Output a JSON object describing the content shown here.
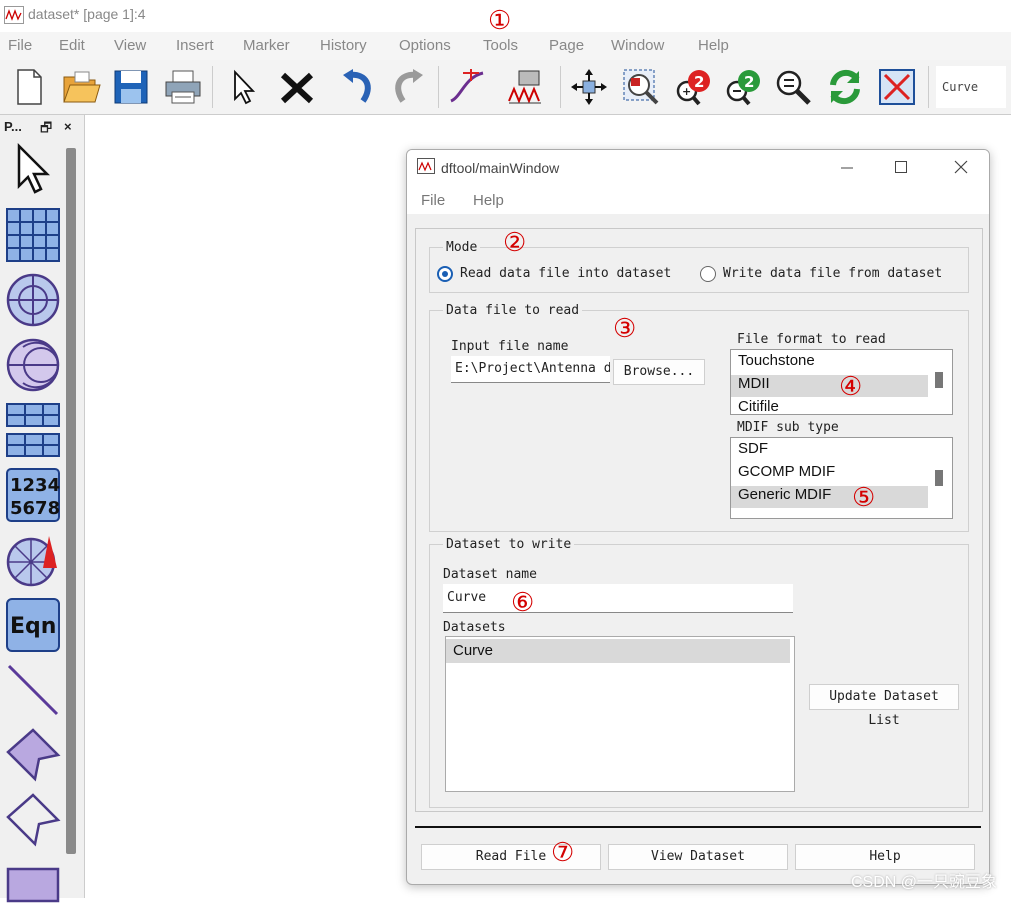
{
  "window": {
    "title": "dataset* [page 1]:4"
  },
  "menu": [
    "File",
    "Edit",
    "View",
    "Insert",
    "Marker",
    "History",
    "Options",
    "Tools",
    "Page",
    "Window",
    "Help"
  ],
  "toolbar": {
    "icons": [
      "new-file-icon",
      "open-folder-icon",
      "save-icon",
      "print-icon",
      "pointer-icon",
      "delete-icon",
      "undo-icon",
      "redo-icon",
      "trace-icon",
      "plot-settings-icon",
      "pan-icon",
      "zoom-box-icon",
      "zoom-in-icon",
      "zoom-out-icon",
      "zoom-fit-icon",
      "refresh-icon",
      "clear-icon"
    ],
    "curve_field": "Curve"
  },
  "palette": {
    "title": "P...",
    "float_glyph": "🗗",
    "close_glyph": "×",
    "items": [
      "pointer-tool",
      "table-tool",
      "polar-plot-tool",
      "smith-chart-tool",
      "stacked-table-tool",
      "list-tool",
      "antenna-plot-tool",
      "equation-tool",
      "line-tool",
      "polygon-tool",
      "polyline-tool",
      "rectangle-tool"
    ],
    "list_text": "1234\n5678",
    "eqn_text": "Eqn"
  },
  "dialog": {
    "title": "dftool/mainWindow",
    "menu": [
      "File",
      "Help"
    ],
    "mode": {
      "title": "Mode",
      "read_label": "Read data file into dataset",
      "write_label": "Write data file from dataset",
      "selected": "read"
    },
    "data_file": {
      "title": "Data file to read",
      "input_label": "Input file name",
      "input_value": "E:\\Project\\Antenna d",
      "browse": "Browse...",
      "format_label": "File format to read",
      "formats": [
        "Touchstone",
        "MDII",
        "Citifile"
      ],
      "selected_format": "MDII",
      "subtype_label": "MDIF sub type",
      "subtypes": [
        "SDF",
        "GCOMP MDIF",
        "Generic MDIF"
      ],
      "selected_subtype": "Generic MDIF"
    },
    "dataset": {
      "title": "Dataset to write",
      "name_label": "Dataset name",
      "name_value": "Curve",
      "datasets_label": "Datasets",
      "datasets": [
        "Curve"
      ],
      "update_button": "Update Dataset List"
    },
    "buttons": {
      "read": "Read File",
      "view": "View Dataset",
      "help": "Help"
    }
  },
  "annotations": [
    "①",
    "②",
    "③",
    "④",
    "⑤",
    "⑥",
    "⑦"
  ],
  "watermark": "CSDN @一只豌豆象"
}
